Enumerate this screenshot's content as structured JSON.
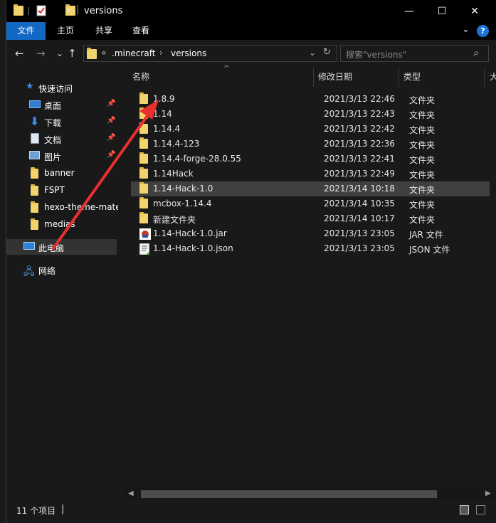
{
  "titlebar": {
    "title": "versions",
    "separator_char": "|",
    "dropdown_char": "▾",
    "minimize": "—",
    "maximize": "☐",
    "close": "✕"
  },
  "ribbon": {
    "tabs": [
      {
        "label": "文件",
        "active": true
      },
      {
        "label": "主页",
        "active": false
      },
      {
        "label": "共享",
        "active": false
      },
      {
        "label": "查看",
        "active": false
      }
    ],
    "collapse_icon": "⌄",
    "help_icon": "?"
  },
  "address": {
    "back": "←",
    "forward": "→",
    "recent": "⌄",
    "up": "↑",
    "overflow": "«",
    "crumbs": [
      ".minecraft",
      "versions"
    ],
    "crumb_sep": "›",
    "dropdown": "⌄",
    "refresh": "↻"
  },
  "search": {
    "placeholder": "搜索\"versions\"",
    "icon": "⌕"
  },
  "sidebar": {
    "quick_access": "快速访问",
    "items": [
      {
        "label": "桌面",
        "pinned": true
      },
      {
        "label": "下载",
        "pinned": true
      },
      {
        "label": "文档",
        "pinned": true
      },
      {
        "label": "图片",
        "pinned": true
      },
      {
        "label": "banner",
        "pinned": false
      },
      {
        "label": "FSPT",
        "pinned": false
      },
      {
        "label": "hexo-theme-mate",
        "pinned": false
      },
      {
        "label": "medias",
        "pinned": false
      }
    ],
    "this_pc": "此电脑",
    "network": "网络"
  },
  "columns": {
    "name": "名称",
    "date": "修改日期",
    "type": "类型",
    "size_partial": "大"
  },
  "files": [
    {
      "name": "1.8.9",
      "date": "2021/3/13 22:46",
      "type": "文件夹",
      "kind": "folder"
    },
    {
      "name": "1.14",
      "date": "2021/3/13 22:43",
      "type": "文件夹",
      "kind": "folder"
    },
    {
      "name": "1.14.4",
      "date": "2021/3/13 22:42",
      "type": "文件夹",
      "kind": "folder"
    },
    {
      "name": "1.14.4-123",
      "date": "2021/3/13 22:36",
      "type": "文件夹",
      "kind": "folder"
    },
    {
      "name": "1.14.4-forge-28.0.55",
      "date": "2021/3/13 22:41",
      "type": "文件夹",
      "kind": "folder"
    },
    {
      "name": "1.14Hack",
      "date": "2021/3/13 22:49",
      "type": "文件夹",
      "kind": "folder"
    },
    {
      "name": "1.14-Hack-1.0",
      "date": "2021/3/14 10:18",
      "type": "文件夹",
      "kind": "folder"
    },
    {
      "name": "mcbox-1.14.4",
      "date": "2021/3/14 10:35",
      "type": "文件夹",
      "kind": "folder"
    },
    {
      "name": "新建文件夹",
      "date": "2021/3/14 10:17",
      "type": "文件夹",
      "kind": "folder"
    },
    {
      "name": "1.14-Hack-1.0.jar",
      "date": "2021/3/13 23:05",
      "type": "JAR 文件",
      "kind": "jar"
    },
    {
      "name": "1.14-Hack-1.0.json",
      "date": "2021/3/13 23:05",
      "type": "JSON 文件",
      "kind": "json"
    }
  ],
  "status": {
    "count": "11 个项目",
    "divider": "|"
  },
  "colors": {
    "accent": "#1368c4",
    "folder": "#f3d36b",
    "arrow": "#e8302e"
  }
}
